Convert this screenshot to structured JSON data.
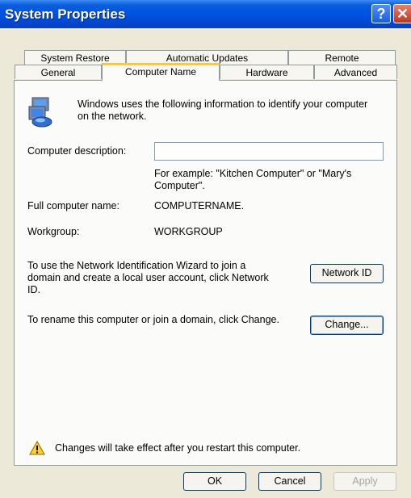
{
  "window": {
    "title": "System Properties"
  },
  "titlebar": {
    "help_glyph": "?",
    "close_glyph": "✕"
  },
  "tabs": {
    "row1": [
      "System Restore",
      "Automatic Updates",
      "Remote"
    ],
    "row2": [
      "General",
      "Computer Name",
      "Hardware",
      "Advanced"
    ],
    "active": "Computer Name"
  },
  "panel": {
    "intro_line1": "Windows uses the following information to identify your computer",
    "intro_line2": "on the network.",
    "description_label": "Computer description:",
    "description_value": "",
    "example_line1": "For example: \"Kitchen Computer\" or \"Mary's",
    "example_line2": "Computer\".",
    "full_name_label": "Full computer name:",
    "full_name_value": "COMPUTERNAME.",
    "workgroup_label": "Workgroup:",
    "workgroup_value": "WORKGROUP",
    "network_id_text1": "To use the Network Identification Wizard to join a",
    "network_id_text2": "domain and create a local user account, click Network",
    "network_id_text3": "ID.",
    "network_id_button": "Network ID",
    "rename_text": "To rename this computer or join a domain, click Change.",
    "change_button": "Change...",
    "warning_text": "Changes will take effect after you restart this computer."
  },
  "footer": {
    "ok": "OK",
    "cancel": "Cancel",
    "apply": "Apply"
  },
  "icons": {
    "computer": "computer-network-icon",
    "warning": "warning-icon"
  },
  "colors": {
    "titlebar": "#0054e3",
    "active_tab_accent": "#ffc73c",
    "dialog_bg": "#ece9d8"
  }
}
